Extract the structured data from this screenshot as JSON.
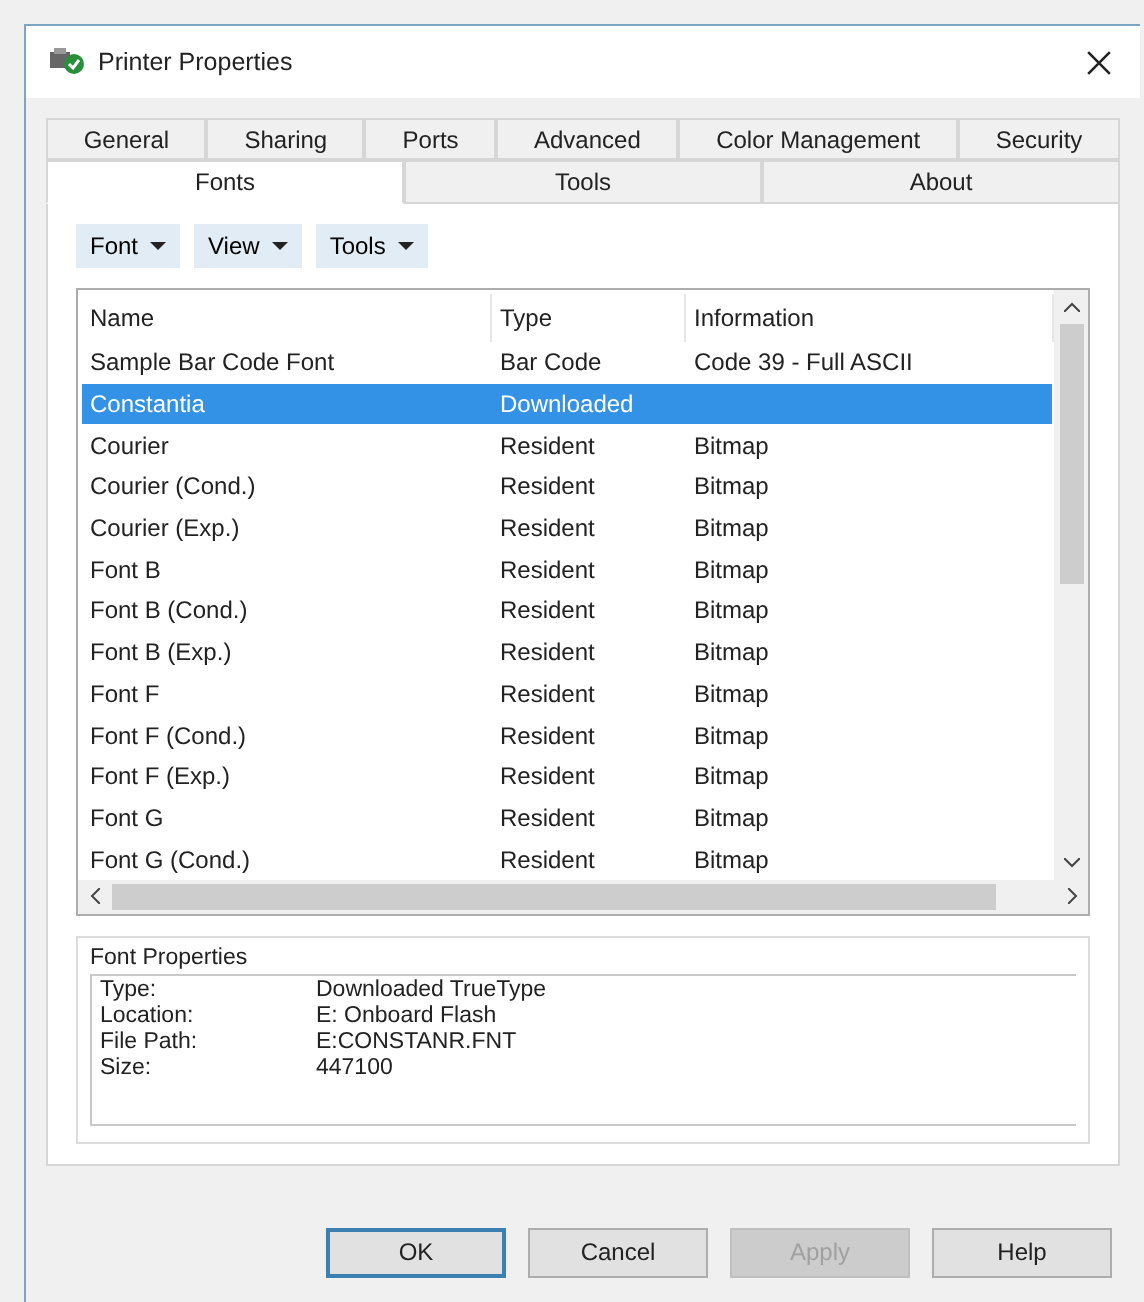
{
  "window": {
    "title": "Printer Properties"
  },
  "tabs_back": [
    {
      "label": "General",
      "selected": false
    },
    {
      "label": "Sharing",
      "selected": false
    },
    {
      "label": "Ports",
      "selected": false
    },
    {
      "label": "Advanced",
      "selected": false
    },
    {
      "label": "Color Management",
      "selected": false
    },
    {
      "label": "Security",
      "selected": false
    }
  ],
  "tabs_front": [
    {
      "label": "Fonts",
      "selected": true
    },
    {
      "label": "Tools",
      "selected": false
    },
    {
      "label": "About",
      "selected": false
    }
  ],
  "toolbar": [
    "Font",
    "View",
    "Tools"
  ],
  "table": {
    "columns": [
      "Name",
      "Type",
      "Information"
    ],
    "rows": [
      {
        "cells": [
          "Sample Bar Code Font",
          "Bar Code",
          "Code 39 - Full ASCII"
        ],
        "selected": false
      },
      {
        "cells": [
          "Constantia",
          "Downloaded",
          ""
        ],
        "selected": true
      },
      {
        "cells": [
          "Courier",
          "Resident",
          "Bitmap"
        ],
        "selected": false
      },
      {
        "cells": [
          "Courier (Cond.)",
          "Resident",
          "Bitmap"
        ],
        "selected": false
      },
      {
        "cells": [
          "Courier (Exp.)",
          "Resident",
          "Bitmap"
        ],
        "selected": false
      },
      {
        "cells": [
          "Font B",
          "Resident",
          "Bitmap"
        ],
        "selected": false
      },
      {
        "cells": [
          "Font B (Cond.)",
          "Resident",
          "Bitmap"
        ],
        "selected": false
      },
      {
        "cells": [
          "Font B (Exp.)",
          "Resident",
          "Bitmap"
        ],
        "selected": false
      },
      {
        "cells": [
          "Font F",
          "Resident",
          "Bitmap"
        ],
        "selected": false
      },
      {
        "cells": [
          "Font F (Cond.)",
          "Resident",
          "Bitmap"
        ],
        "selected": false
      },
      {
        "cells": [
          "Font F (Exp.)",
          "Resident",
          "Bitmap"
        ],
        "selected": false
      },
      {
        "cells": [
          "Font G",
          "Resident",
          "Bitmap"
        ],
        "selected": false
      },
      {
        "cells": [
          "Font G (Cond.)",
          "Resident",
          "Bitmap"
        ],
        "selected": false
      }
    ]
  },
  "properties": {
    "title": "Font Properties",
    "items": [
      {
        "label": "Type:",
        "value": "Downloaded TrueType"
      },
      {
        "label": "Location:",
        "value": "E: Onboard Flash"
      },
      {
        "label": "File Path:",
        "value": "E:CONSTANR.FNT"
      },
      {
        "label": "Size:",
        "value": "447100"
      }
    ]
  },
  "buttons": [
    {
      "label": "OK",
      "disabled": false,
      "default": true
    },
    {
      "label": "Cancel",
      "disabled": false,
      "default": false
    },
    {
      "label": "Apply",
      "disabled": true,
      "default": false
    },
    {
      "label": "Help",
      "disabled": false,
      "default": false
    }
  ]
}
